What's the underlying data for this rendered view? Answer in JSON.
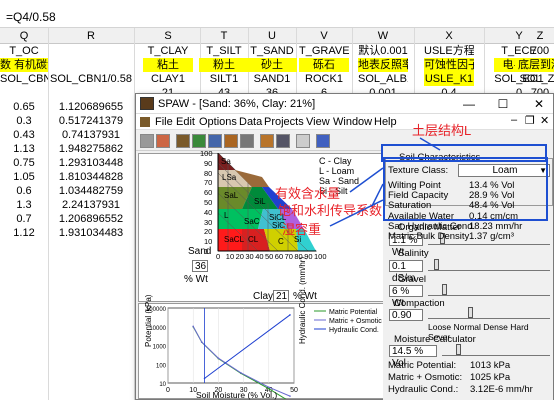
{
  "formula_bar": {
    "content": "=Q4/0.58"
  },
  "sheet": {
    "columns": [
      {
        "letter": "Q"
      },
      {
        "letter": "R"
      },
      {
        "letter": "S"
      },
      {
        "letter": "T"
      },
      {
        "letter": "U"
      },
      {
        "letter": "V"
      },
      {
        "letter": "W"
      },
      {
        "letter": "X"
      },
      {
        "letter": "Y"
      },
      {
        "letter": "Z"
      }
    ],
    "header_row1": [
      "T_OC",
      "",
      "T_CLAY",
      "T_SILT",
      "T_SAND",
      "T_GRAVEL",
      "默认0.001",
      "USLE方程",
      "T_ECE",
      "700"
    ],
    "header_row2": [
      "数 有机碳含量",
      "",
      "粘土",
      "粉土",
      "砂土",
      "砾石",
      "地表反照率",
      "可蚀性因子",
      "电导率",
      "底层到深"
    ],
    "header_row3": [
      "SOL_CBN1",
      "SOL_CBN1/0.58",
      "CLAY1",
      "SILT1",
      "SAND1",
      "ROCK1",
      "SOL_ALB1",
      "USLE_K1",
      "SOL_EC1",
      "SOL_Z2"
    ],
    "header_row4": [
      "",
      "",
      "21",
      "43",
      "36",
      "6",
      "0.001",
      "0.4",
      "0",
      "700"
    ],
    "q_values": [
      "0.65",
      "0.3",
      "0.43",
      "1.13",
      "0.75",
      "1.05",
      "0.6",
      "1.3",
      "0.7",
      "1.12"
    ],
    "r_values": [
      "1.120689655",
      "0.517241379",
      "0.74137931",
      "1.948275862",
      "1.293103448",
      "1.810344828",
      "1.034482759",
      "2.24137931",
      "1.206896552",
      "1.931034483"
    ]
  },
  "window": {
    "title": "SPAW - [Sand: 36%, Clay: 21%]",
    "menu": [
      "File",
      "Edit",
      "Options",
      "Data",
      "Projects",
      "View",
      "Window",
      "Help"
    ],
    "texture": {
      "axis_left_title": "Sand",
      "sand_value": "36",
      "sand_unit": "% Wt",
      "clay_label": "Clay",
      "clay_value": "21",
      "clay_unit": "% Wt",
      "legend": [
        "C - Clay",
        "L - Loam",
        "Sa - Sand",
        "Si - Silt"
      ],
      "ticks_y": [
        "100",
        "90",
        "80",
        "70",
        "60",
        "50",
        "40",
        "30",
        "20",
        "10",
        "0"
      ],
      "ticks_x": [
        "0",
        "10",
        "20",
        "30",
        "40",
        "50",
        "60",
        "70",
        "80",
        "90",
        "100"
      ],
      "zone_labels": [
        "Sa",
        "LSa",
        "SaL",
        "L",
        "SaCL",
        "CL",
        "SiL",
        "SiCL",
        "SiC",
        "C",
        "SaC",
        "Si"
      ]
    },
    "soil_char": {
      "title": "Soil Characteristics",
      "texture_class_label": "Texture Class:",
      "texture_class_value": "Loam",
      "rows": [
        {
          "label": "Wilting Point",
          "value": "13.4 % Vol"
        },
        {
          "label": "Field Capacity",
          "value": "28.9 % Vol"
        },
        {
          "label": "Saturation",
          "value": "48.4 % Vol"
        },
        {
          "label": "Available Water",
          "value": "0.14 cm/cm"
        },
        {
          "label": "Sat. Hydraulic Cond.",
          "value": "18.23 mm/hr"
        },
        {
          "label": "Matric Bulk Density",
          "value": "1.37 g/cm³"
        }
      ]
    },
    "organic": {
      "title": "Organic Matter",
      "value": "1.1 % Wt"
    },
    "salinity": {
      "title": "Salinity",
      "value": "0.1 dS/m"
    },
    "gravel": {
      "title": "Gravel",
      "value": "6 % Wt"
    },
    "compaction": {
      "title": "Compaction",
      "value": "0.90",
      "scale": "Loose Normal Dense  Hard  Sever"
    },
    "moisture": {
      "title": "Moisture Calculator",
      "value": "14.5 % Vol",
      "rows": [
        {
          "label": "Matric Potential:",
          "value": "1013 kPa"
        },
        {
          "label": "Matric + Osmotic:",
          "value": "1025 kPa"
        },
        {
          "label": "Hydraulic Cond.:",
          "value": "3.12E-6 mm/hr"
        }
      ]
    },
    "chart_labels": {
      "ylabel": "Potential (kPa)",
      "ylabel2": "Hydraulic Cond. (mm/hr)",
      "xlabel": "Soil Moisture (% Vol.)",
      "legend": [
        "Matric Potential",
        "Matric + Osmotic",
        "Hydraulic Cond."
      ],
      "yticks": [
        "100000",
        "10000",
        "1000",
        "100",
        "10"
      ],
      "xticks": [
        "0",
        "10",
        "20",
        "30",
        "40",
        "50"
      ]
    }
  },
  "annotations": {
    "soil_structure": "土层结构L",
    "available_water": "有效含水量",
    "sat_cond": "饱和水利传导系数",
    "bulk_density": "湿容重"
  },
  "chart_data": {
    "type": "line",
    "title": "",
    "xlabel": "Soil Moisture (% Vol.)",
    "ylabel": "Potential (kPa)",
    "xlim": [
      0,
      50
    ],
    "ylim": [
      10,
      100000
    ],
    "yscale": "log",
    "series": [
      {
        "name": "Matric Potential",
        "x": [
          10,
          13.4,
          20,
          28.9,
          40,
          48.4
        ],
        "y": [
          10000,
          1500,
          200,
          33,
          5,
          1
        ]
      },
      {
        "name": "Matric + Osmotic",
        "x": [
          10,
          13.4,
          20,
          28.9,
          40,
          48.4
        ],
        "y": [
          10500,
          1525,
          210,
          35,
          6,
          2
        ]
      },
      {
        "name": "Hydraulic Cond.",
        "x": [
          14.5,
          48.4
        ],
        "y": [
          3.12e-06,
          18.23
        ]
      }
    ]
  }
}
